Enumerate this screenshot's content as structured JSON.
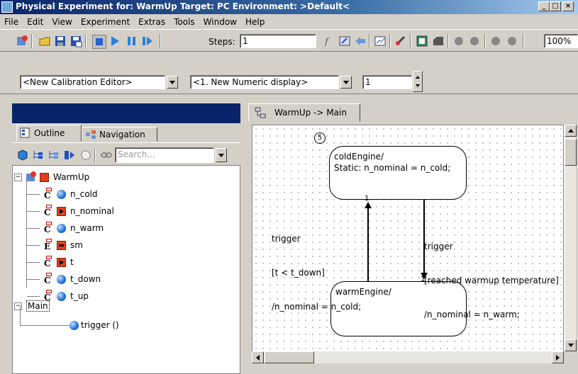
{
  "window": {
    "title": "Physical Experiment for: WarmUp  Target: PC  Environment: >Default<"
  },
  "menu": [
    "File",
    "Edit",
    "View",
    "Experiment",
    "Extras",
    "Tools",
    "Window",
    "Help"
  ],
  "toolbar": {
    "steps_label": "Steps:",
    "steps_value": "1",
    "zoom_value": "100%"
  },
  "calibration_row": {
    "calibration_editor": "<New Calibration Editor>",
    "numeric_display": "<1. New Numeric display>",
    "spinner_value": "1"
  },
  "left_panel": {
    "tabs": [
      {
        "label": "Outline"
      },
      {
        "label": "Navigation"
      }
    ],
    "search_placeholder": "Search...",
    "tree": {
      "root": "WarmUp",
      "items": [
        {
          "label": "n_cold",
          "kind": "C",
          "marker": "ball"
        },
        {
          "label": "n_nominal",
          "kind": "C",
          "marker": "red-arrow"
        },
        {
          "label": "n_warm",
          "kind": "C",
          "marker": "ball"
        },
        {
          "label": "sm",
          "kind": "E",
          "marker": "red-minus"
        },
        {
          "label": "t",
          "kind": "C",
          "marker": "red-arrow"
        },
        {
          "label": "t_down",
          "kind": "C",
          "marker": "ball"
        },
        {
          "label": "t_up",
          "kind": "C",
          "marker": "ball"
        }
      ],
      "main": "Main",
      "main_items": [
        {
          "label": "trigger ()"
        }
      ]
    }
  },
  "diagram": {
    "tab_label": "WarmUp -> Main",
    "circle_marker": "5",
    "states": [
      {
        "name": "coldEngine/",
        "body": "Static: n_nominal = n_cold;"
      },
      {
        "name": "warmEngine/",
        "body": ""
      }
    ],
    "transitions": [
      {
        "lines": [
          "trigger",
          "[t < t_down]",
          "/n_nominal = n_cold;"
        ],
        "priority": "1"
      },
      {
        "lines": [
          "trigger",
          "[reached warmup temperature]",
          "/n_nominal = n_warm;"
        ],
        "priority": "1"
      }
    ]
  },
  "colors": {
    "title_bar": "#0a246a",
    "panel_header": "#0a246a",
    "window_bg": "#d4d0c8"
  }
}
